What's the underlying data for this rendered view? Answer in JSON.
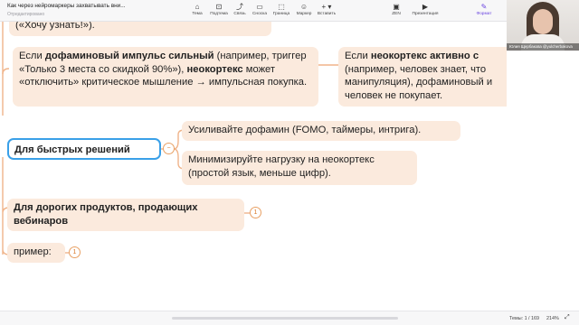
{
  "app": {
    "title": "Как через нейромаркеры захватывать вни...",
    "subtitle": "Отредактировано"
  },
  "toolbar": {
    "items": [
      {
        "icon": "topic-icon",
        "label": "Тема"
      },
      {
        "icon": "subtopic-icon",
        "label": "Подтема"
      },
      {
        "icon": "relationship-icon",
        "label": "Связь"
      },
      {
        "icon": "callout-icon",
        "label": "Сноска"
      },
      {
        "icon": "boundary-icon",
        "label": "Граница"
      },
      {
        "icon": "marker-icon",
        "label": "Маркер"
      },
      {
        "icon": "insert-icon",
        "label": "Вставить"
      },
      {
        "icon": "zen-icon",
        "label": "ZEN"
      },
      {
        "icon": "presentation-icon",
        "label": "Презентация"
      },
      {
        "icon": "format-icon",
        "label": "Формат"
      }
    ],
    "accent_color": "#6b46e0"
  },
  "video": {
    "caption": "Юлия Щербакова @yulcherbakova"
  },
  "mindmap": {
    "colors": {
      "node_fill": "#fbeadd",
      "line": "#f0b48a",
      "selected_border": "#3aa0e8"
    },
    "nodes": {
      "top_cut": "(«Хочу узнать!»).",
      "dopamine_p1": "Если ",
      "dopamine_bold1": "дофаминовый импульс сильный",
      "dopamine_p2": " (например, триггер «Только 3 места со скидкой 90%»), ",
      "dopamine_bold2": "неокортекс",
      "dopamine_p3": " может «отключить» критическое мышление → импульсная покупка.",
      "neocortex_p1": "Если ",
      "neocortex_bold": "неокортекс активно с",
      "neocortex_p2": " (например, человек знает, что манипуляция), дофаминовый и человек не покупает.",
      "fast_decisions": "Для быстрых решений",
      "fast_child_1": "Усиливайте дофамин (FOMO, таймеры, интрига).",
      "fast_child_2": "Минимизируйте нагрузку на неокортекс (простой язык, меньше цифр).",
      "expensive": "Для дорогих продуктов, продающих вебинаров",
      "example": "пример:"
    },
    "collapsed_counts": {
      "expensive": "1",
      "example": "1"
    },
    "collapse_symbol": "−"
  },
  "status": {
    "topics": "Темы: 1 / 169",
    "zoom": "214%",
    "expand_icon": "expand-icon"
  }
}
